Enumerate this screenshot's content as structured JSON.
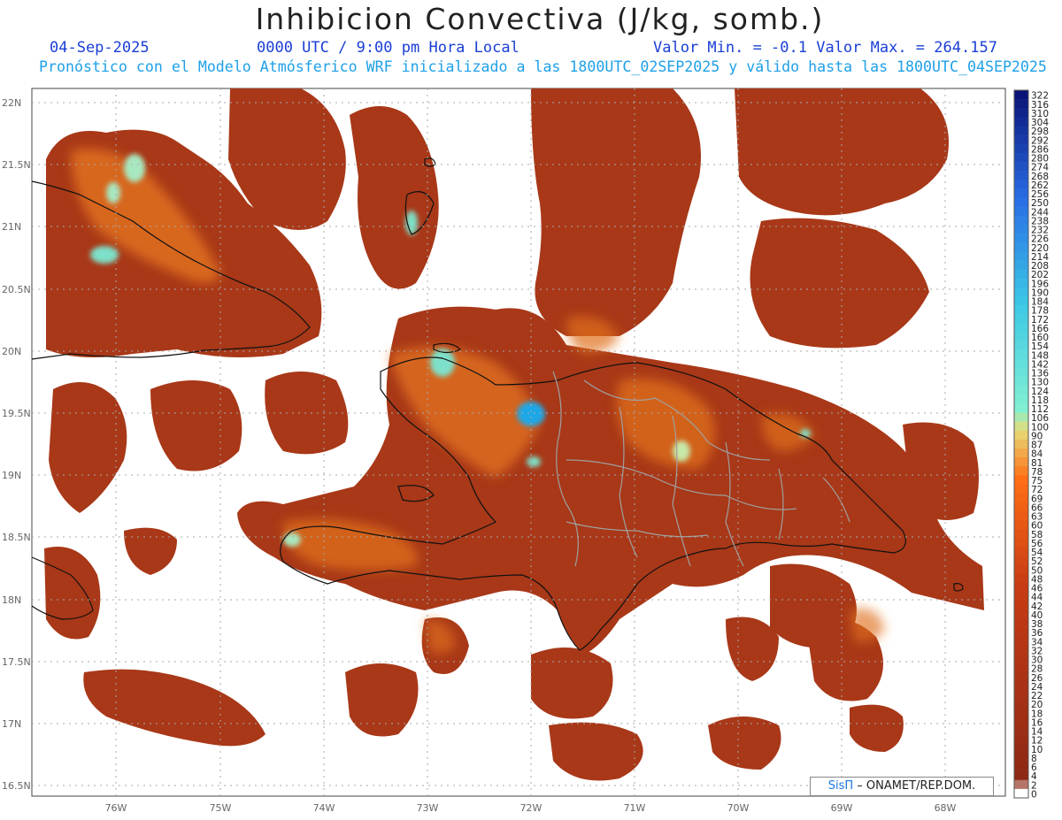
{
  "title": "Inhibicion Convectiva (J/kg, somb.)",
  "date": "04-Sep-2025",
  "time_label": "0000 UTC / 9:00 pm Hora Local",
  "minmax": "Valor Min. = -0.1  Valor Max. = 264.157",
  "model_line": "Pronóstico con el Modelo Atmósferico WRF inicializado a las 1800UTC_02SEP2025 y válido hasta las  1800UTC_04SEP2025",
  "lat_labels": [
    "22N",
    "21.5N",
    "21N",
    "20.5N",
    "20N",
    "19.5N",
    "19N",
    "18.5N",
    "18N",
    "17.5N",
    "17N",
    "16.5N"
  ],
  "lon_labels": [
    "76W",
    "75W",
    "74W",
    "73W",
    "72W",
    "71W",
    "70W",
    "69W",
    "68W"
  ],
  "colorbar_labels": [
    "322",
    "316",
    "310",
    "304",
    "298",
    "292",
    "286",
    "280",
    "274",
    "268",
    "262",
    "256",
    "250",
    "244",
    "238",
    "232",
    "226",
    "220",
    "214",
    "208",
    "202",
    "196",
    "190",
    "184",
    "178",
    "172",
    "166",
    "160",
    "154",
    "148",
    "142",
    "136",
    "130",
    "124",
    "118",
    "112",
    "106",
    "100",
    "90",
    "87",
    "84",
    "81",
    "78",
    "75",
    "72",
    "69",
    "66",
    "63",
    "60",
    "58",
    "56",
    "54",
    "52",
    "50",
    "48",
    "46",
    "44",
    "42",
    "40",
    "38",
    "36",
    "34",
    "32",
    "30",
    "28",
    "26",
    "24",
    "22",
    "20",
    "18",
    "16",
    "14",
    "12",
    "10",
    "8",
    "6",
    "4",
    "2",
    "0"
  ],
  "credit": {
    "brand": "SisΠ",
    "text": " – ONAMET/REP.DOM."
  },
  "colors": {
    "field": "#a83818",
    "accent": "#e0701e",
    "high": "#7ee0c8",
    "peak": "#1ea8e8",
    "coast": "#111111",
    "provinces": "#a0a0a0"
  }
}
